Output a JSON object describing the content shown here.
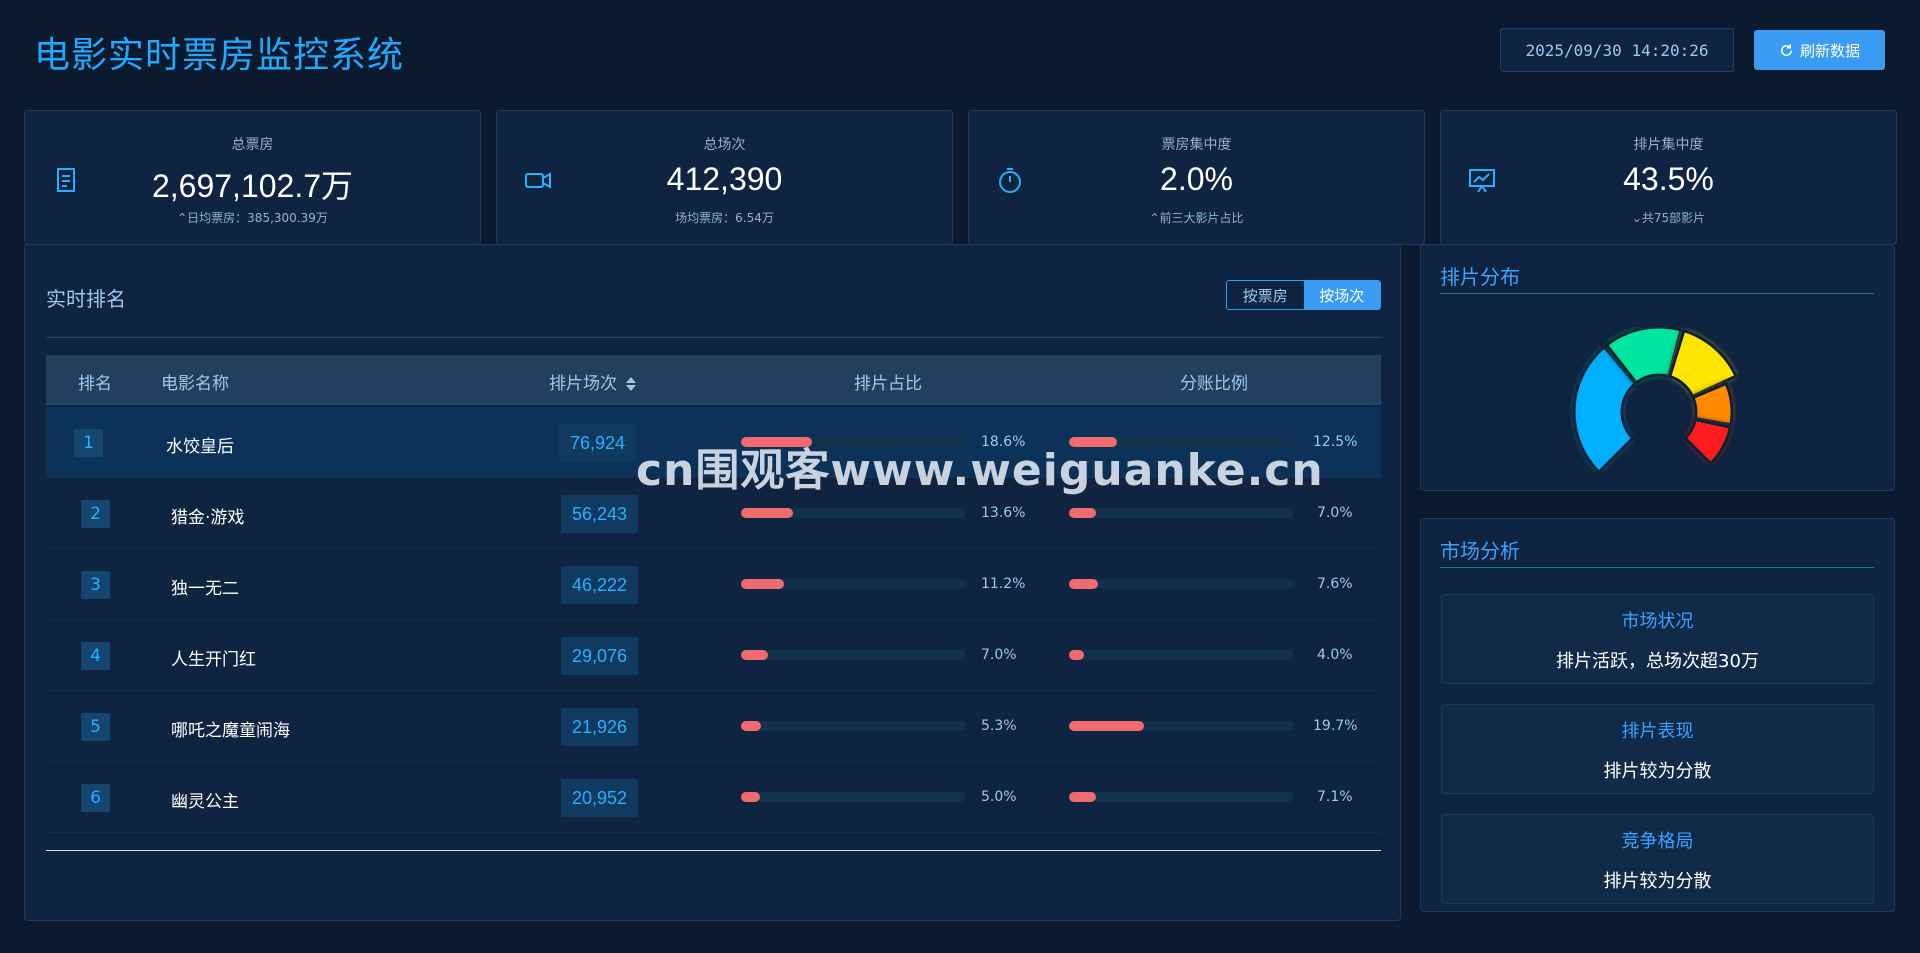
{
  "app_title": "电影实时票房监控系统",
  "datetime": "2025/09/30 14:20:26",
  "refresh_label": "刷新数据",
  "stats": [
    {
      "icon": "document-icon",
      "label": "总票房",
      "value": "2,697,102.7万",
      "sub": "日均票房：385,300.39万",
      "trend": "up"
    },
    {
      "icon": "video-camera-icon",
      "label": "总场次",
      "value": "412,390",
      "sub": "场均票房：6.54万",
      "trend": ""
    },
    {
      "icon": "stopwatch-icon",
      "label": "票房集中度",
      "value": "2.0%",
      "sub": "前三大影片占比",
      "trend": "up"
    },
    {
      "icon": "presentation-chart-icon",
      "label": "排片集中度",
      "value": "43.5%",
      "sub": "共75部影片",
      "trend": "down"
    }
  ],
  "ranking": {
    "title": "实时排名",
    "toggle": {
      "by_box": "按票房",
      "by_shows": "按场次",
      "active": "by_shows"
    },
    "columns": {
      "rank": "排名",
      "name": "电影名称",
      "shows": "排片场次",
      "share": "排片占比",
      "split": "分账比例"
    },
    "rows": [
      {
        "rank": "1",
        "name": "水饺皇后",
        "shows": "76,924",
        "share_pct": "18.6%",
        "share": 18.6,
        "split_pct": "12.5%",
        "split": 12.5
      },
      {
        "rank": "2",
        "name": "猎金·游戏",
        "shows": "56,243",
        "share_pct": "13.6%",
        "share": 13.6,
        "split_pct": "7.0%",
        "split": 7.0
      },
      {
        "rank": "3",
        "name": "独一无二",
        "shows": "46,222",
        "share_pct": "11.2%",
        "share": 11.2,
        "split_pct": "7.6%",
        "split": 7.6
      },
      {
        "rank": "4",
        "name": "人生开门红",
        "shows": "29,076",
        "share_pct": "7.0%",
        "share": 7.0,
        "split_pct": "4.0%",
        "split": 4.0
      },
      {
        "rank": "5",
        "name": "哪吒之魔童闹海",
        "shows": "21,926",
        "share_pct": "5.3%",
        "share": 5.3,
        "split_pct": "19.7%",
        "split": 19.7
      },
      {
        "rank": "6",
        "name": "幽灵公主",
        "shows": "20,952",
        "share_pct": "5.0%",
        "share": 5.0,
        "split_pct": "7.1%",
        "split": 7.1
      }
    ]
  },
  "distribution": {
    "title": "排片分布",
    "segment_colors": [
      "#00b0ff",
      "#00e5a0",
      "#ffe600",
      "#ff8a00",
      "#ff1a1a"
    ]
  },
  "market": {
    "title": "市场分析",
    "items": [
      {
        "title": "市场状况",
        "text": "排片活跃，总场次超30万"
      },
      {
        "title": "排片表现",
        "text": "排片较为分散"
      },
      {
        "title": "竞争格局",
        "text": "排片较为分散"
      }
    ]
  },
  "watermark": "cn围观客www.weiguanke.cn"
}
